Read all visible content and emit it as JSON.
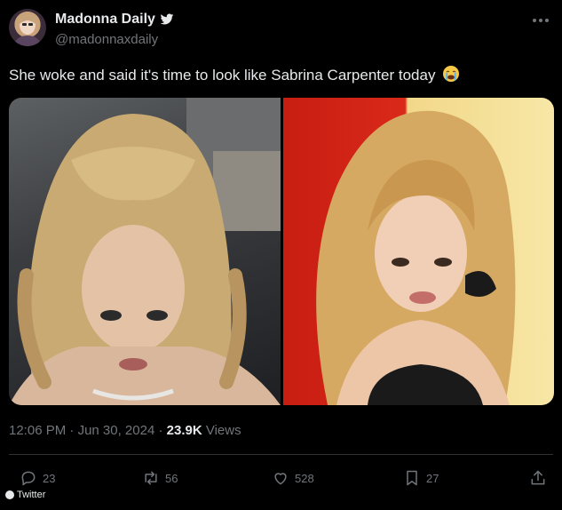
{
  "author": {
    "display_name": "Madonna Daily",
    "handle": "@madonnaxdaily",
    "avatar_icon": "avatar-photo",
    "verified_icon": "bird-icon"
  },
  "tweet": {
    "text": "She woke and said it's time to look like Sabrina Carpenter today",
    "emoji": "loudly-crying-face-icon"
  },
  "media": {
    "images": [
      {
        "name": "madonna-photo"
      },
      {
        "name": "sabrina-carpenter-photo"
      }
    ]
  },
  "meta": {
    "time": "12:06 PM",
    "separator": "·",
    "date": "Jun 30, 2024",
    "views_count": "23.9K",
    "views_label": "Views"
  },
  "actions": {
    "replies": "23",
    "retweets": "56",
    "likes": "528",
    "bookmarks": "27"
  },
  "watermark": {
    "label": "Twitter"
  },
  "colors": {
    "background": "#000000",
    "text_primary": "#e7e9ea",
    "text_secondary": "#71767b",
    "divider": "#2f3336"
  }
}
